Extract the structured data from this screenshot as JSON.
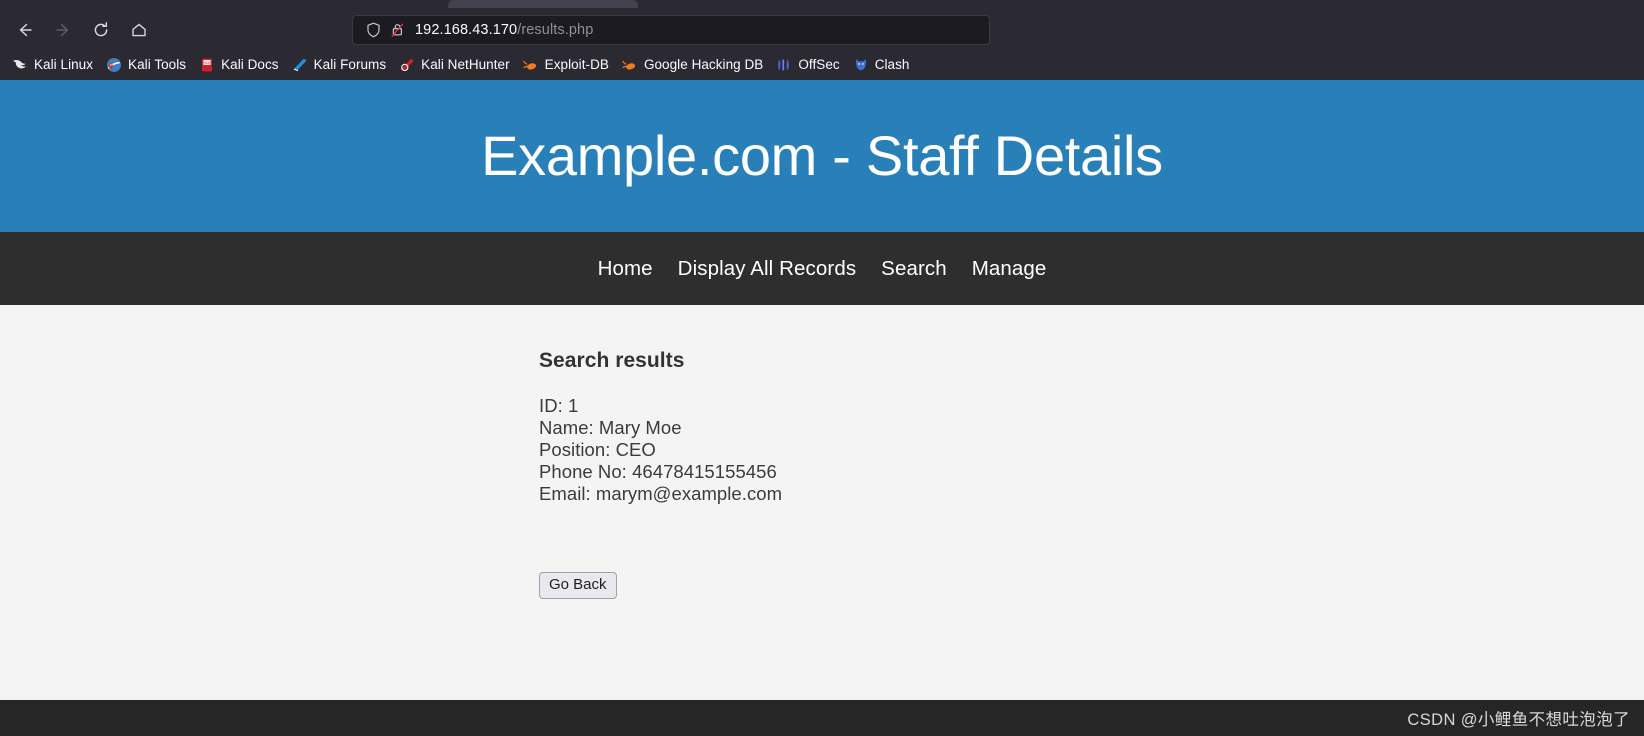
{
  "browser": {
    "nav": {
      "back_label": "Back",
      "forward_label": "Forward",
      "reload_label": "Reload",
      "home_label": "Home"
    },
    "address_bar": {
      "host": "192.168.43.170",
      "path": "/results.php",
      "shield_icon": "shield-icon",
      "lock_icon": "lock-crossed-icon"
    },
    "bookmarks": [
      {
        "label": "Kali Linux",
        "icon": "kali-dragon-icon",
        "color": "#e8e8e8"
      },
      {
        "label": "Kali Tools",
        "icon": "kali-tools-icon",
        "color": "#3f7fbf"
      },
      {
        "label": "Kali Docs",
        "icon": "kali-docs-book-icon",
        "color": "#cf2029"
      },
      {
        "label": "Kali Forums",
        "icon": "kali-forums-icon",
        "color": "#1f8fe0"
      },
      {
        "label": "Kali NetHunter",
        "icon": "kali-nethunter-icon",
        "color": "#d42027"
      },
      {
        "label": "Exploit-DB",
        "icon": "exploit-db-flame-icon",
        "color": "#f07a1f"
      },
      {
        "label": "Google Hacking DB",
        "icon": "google-hacking-db-flame-icon",
        "color": "#f07a1f"
      },
      {
        "label": "OffSec",
        "icon": "offsec-icon",
        "color": "#4a5fd0"
      },
      {
        "label": "Clash",
        "icon": "clash-cat-icon",
        "color": "#3b6fd4"
      }
    ]
  },
  "site": {
    "title": "Example.com - Staff Details",
    "header_color": "#2980b9",
    "nav_color": "#2e2e2e",
    "nav_items": [
      {
        "label": "Home"
      },
      {
        "label": "Display All Records"
      },
      {
        "label": "Search"
      },
      {
        "label": "Manage"
      }
    ]
  },
  "results": {
    "heading": "Search results",
    "lines": [
      "ID: 1",
      "Name: Mary Moe",
      "Position: CEO",
      "Phone No: 46478415155456",
      "Email: marym@example.com"
    ],
    "fields": {
      "id": "1",
      "name": "Mary Moe",
      "position": "CEO",
      "phone": "46478415155456",
      "email": "marym@example.com"
    },
    "go_back_label": "Go Back"
  },
  "footer": {
    "watermark": "CSDN @小鲤鱼不想吐泡泡了"
  }
}
